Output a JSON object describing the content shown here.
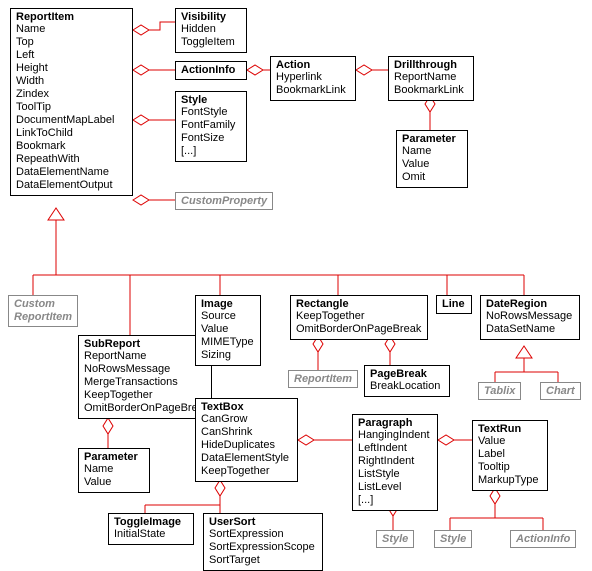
{
  "boxes": {
    "reportItem": {
      "title": "ReportItem",
      "attrs": [
        "Name",
        "Top",
        "Left",
        "Height",
        "Width",
        "Zindex",
        "ToolTip",
        "DocumentMapLabel",
        "LinkToChild",
        "Bookmark",
        "RepeathWith",
        "DataElementName",
        "DataElementOutput"
      ]
    },
    "visibility": {
      "title": "Visibility",
      "attrs": [
        "Hidden",
        "ToggleItem"
      ]
    },
    "actionInfo": {
      "title": "ActionInfo",
      "attrs": []
    },
    "style": {
      "title": "Style",
      "attrs": [
        "FontStyle",
        "FontFamily",
        "FontSize",
        "[...]"
      ]
    },
    "action": {
      "title": "Action",
      "attrs": [
        "Hyperlink",
        "BookmarkLink"
      ]
    },
    "drillthrough": {
      "title": "Drillthrough",
      "attrs": [
        "ReportName",
        "BookmarkLink"
      ]
    },
    "parameter1": {
      "title": "Parameter",
      "attrs": [
        "Name",
        "Value",
        "Omit"
      ]
    },
    "subReport": {
      "title": "SubReport",
      "attrs": [
        "ReportName",
        "NoRowsMessage",
        "MergeTransactions",
        "KeepTogether",
        "OmitBorderOnPageBreak"
      ]
    },
    "parameter2": {
      "title": "Parameter",
      "attrs": [
        "Name",
        "Value"
      ]
    },
    "image": {
      "title": "Image",
      "attrs": [
        "Source",
        "Value",
        "MIMEType",
        "Sizing"
      ]
    },
    "textBox": {
      "title": "TextBox",
      "attrs": [
        "CanGrow",
        "CanShrink",
        "HideDuplicates",
        "DataElementStyle",
        "KeepTogether"
      ]
    },
    "toggleImage": {
      "title": "ToggleImage",
      "attrs": [
        "InitialState"
      ]
    },
    "userSort": {
      "title": "UserSort",
      "attrs": [
        "SortExpression",
        "SortExpressionScope",
        "SortTarget"
      ]
    },
    "rectangle": {
      "title": "Rectangle",
      "attrs": [
        "KeepTogether",
        "OmitBorderOnPageBreak"
      ]
    },
    "pageBreak": {
      "title": "PageBreak",
      "attrs": [
        "BreakLocation"
      ]
    },
    "line": {
      "title": "Line",
      "attrs": []
    },
    "dateRegion": {
      "title": "DateRegion",
      "attrs": [
        "NoRowsMessage",
        "DataSetName"
      ]
    },
    "paragraph": {
      "title": "Paragraph",
      "attrs": [
        "HangingIndent",
        "LeftIndent",
        "RightIndent",
        "ListStyle",
        "ListLevel",
        "[...]"
      ]
    },
    "textRun": {
      "title": "TextRun",
      "attrs": [
        "Value",
        "Label",
        "Tooltip",
        "MarkupType"
      ]
    }
  },
  "refs": {
    "customProperty": "CustomProperty",
    "customReportItem": "Custom\nReportItem",
    "reportItemRef": "ReportItem",
    "tablix": "Tablix",
    "chart": "Chart",
    "style1": "Style",
    "style2": "Style",
    "actionInfoRef": "ActionInfo"
  }
}
